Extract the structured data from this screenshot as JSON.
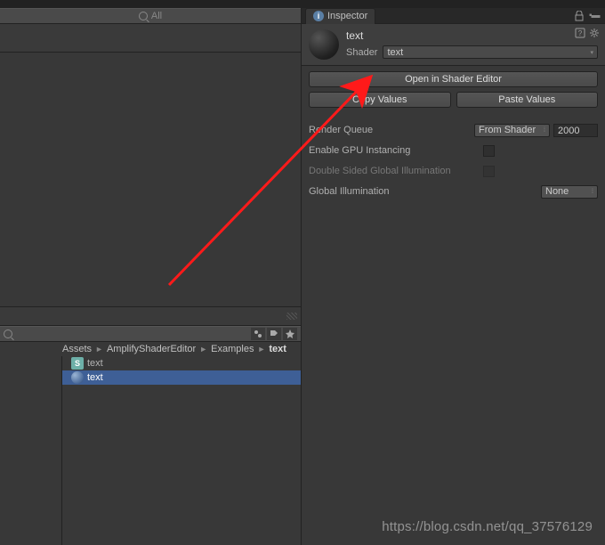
{
  "hierarchy": {
    "search_placeholder": "All"
  },
  "project": {
    "breadcrumb": [
      "Assets",
      "AmplifyShaderEditor",
      "Examples",
      "text"
    ],
    "items": [
      {
        "icon": "shader",
        "label": "text",
        "letter": "S"
      },
      {
        "icon": "material",
        "label": "text"
      }
    ]
  },
  "inspector": {
    "tab_label": "Inspector",
    "material_name": "text",
    "shader_label": "Shader",
    "shader_value": "text",
    "open_btn": "Open in Shader Editor",
    "copy_btn": "Copy Values",
    "paste_btn": "Paste Values",
    "render_queue_label": "Render Queue",
    "render_queue_mode": "From Shader",
    "render_queue_value": "2000",
    "gpu_instancing_label": "Enable GPU Instancing",
    "dsgi_label": "Double Sided Global Illumination",
    "gi_label": "Global Illumination",
    "gi_value": "None"
  },
  "watermark": "https://blog.csdn.net/qq_37576129"
}
